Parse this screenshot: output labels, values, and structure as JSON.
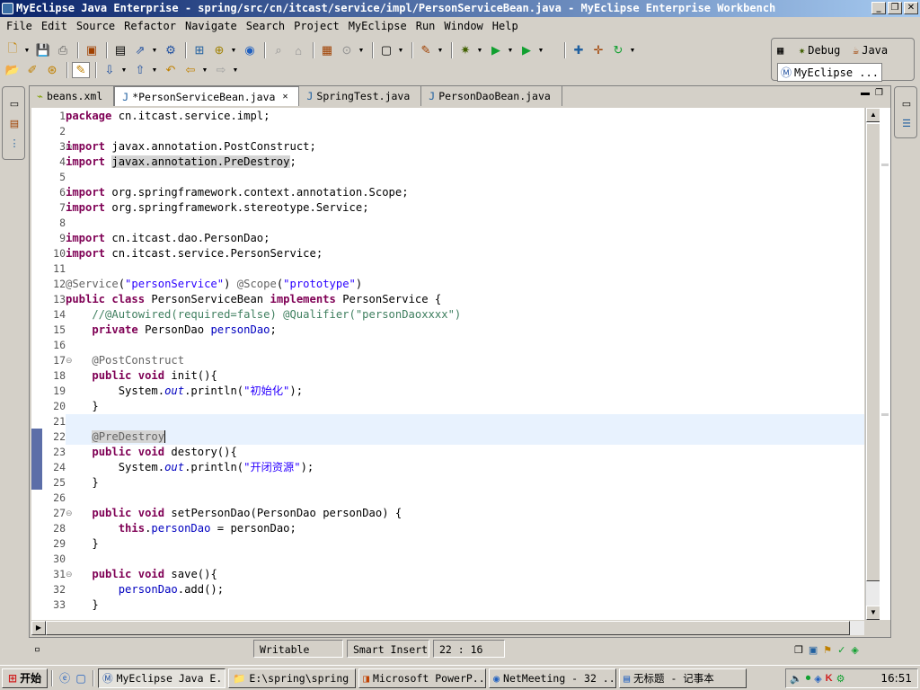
{
  "window": {
    "title": "MyEclipse Java Enterprise - spring/src/cn/itcast/service/impl/PersonServiceBean.java - MyEclipse Enterprise Workbench"
  },
  "menu": [
    "File",
    "Edit",
    "Source",
    "Refactor",
    "Navigate",
    "Search",
    "Project",
    "MyEclipse",
    "Run",
    "Window",
    "Help"
  ],
  "perspectives": {
    "debug": "Debug",
    "java": "Java",
    "myeclipse": "MyEclipse ..."
  },
  "tabs": [
    {
      "label": "beans.xml",
      "icon": "xml-file-icon",
      "active": false
    },
    {
      "label": "*PersonServiceBean.java",
      "icon": "java-file-icon",
      "active": true
    },
    {
      "label": "SpringTest.java",
      "icon": "java-file-icon",
      "active": false
    },
    {
      "label": "PersonDaoBean.java",
      "icon": "java-file-icon",
      "active": false
    }
  ],
  "code": {
    "lines": [
      {
        "n": "1",
        "text": "package cn.itcast.service.impl;"
      },
      {
        "n": "2",
        "text": ""
      },
      {
        "n": "3",
        "text": "import javax.annotation.PostConstruct;"
      },
      {
        "n": "4",
        "text": "import javax.annotation.PreDestroy;"
      },
      {
        "n": "5",
        "text": ""
      },
      {
        "n": "6",
        "text": "import org.springframework.context.annotation.Scope;"
      },
      {
        "n": "7",
        "text": "import org.springframework.stereotype.Service;"
      },
      {
        "n": "8",
        "text": ""
      },
      {
        "n": "9",
        "text": "import cn.itcast.dao.PersonDao;"
      },
      {
        "n": "10",
        "text": "import cn.itcast.service.PersonService;"
      },
      {
        "n": "11",
        "text": ""
      },
      {
        "n": "12",
        "text": "@Service(\"personService\") @Scope(\"prototype\")"
      },
      {
        "n": "13",
        "text": "public class PersonServiceBean implements PersonService {"
      },
      {
        "n": "14",
        "text": "    //@Autowired(required=false) @Qualifier(\"personDaoxxxx\")"
      },
      {
        "n": "15",
        "text": "    private PersonDao personDao;"
      },
      {
        "n": "16",
        "text": ""
      },
      {
        "n": "17",
        "text": "    @PostConstruct"
      },
      {
        "n": "18",
        "text": "    public void init(){"
      },
      {
        "n": "19",
        "text": "        System.out.println(\"初始化\");"
      },
      {
        "n": "20",
        "text": "    }"
      },
      {
        "n": "21",
        "text": ""
      },
      {
        "n": "22",
        "text": "    @PreDestroy"
      },
      {
        "n": "23",
        "text": "    public void destory(){"
      },
      {
        "n": "24",
        "text": "        System.out.println(\"开闭资源\");"
      },
      {
        "n": "25",
        "text": "    }"
      },
      {
        "n": "26",
        "text": ""
      },
      {
        "n": "27",
        "text": "    public void setPersonDao(PersonDao personDao) {"
      },
      {
        "n": "28",
        "text": "        this.personDao = personDao;"
      },
      {
        "n": "29",
        "text": "    }"
      },
      {
        "n": "30",
        "text": ""
      },
      {
        "n": "31",
        "text": "    public void save(){"
      },
      {
        "n": "32",
        "text": "        personDao.add();"
      },
      {
        "n": "33",
        "text": "    }"
      }
    ]
  },
  "status": {
    "writable": "Writable",
    "insert_mode": "Smart Insert",
    "position": "22 : 16"
  },
  "taskbar": {
    "start": "开始",
    "tasks": [
      "MyEclipse Java E...",
      "E:\\spring\\spring",
      "Microsoft PowerP...",
      "NetMeeting - 32 ...",
      "无标题 - 记事本"
    ],
    "clock": "16:51"
  }
}
